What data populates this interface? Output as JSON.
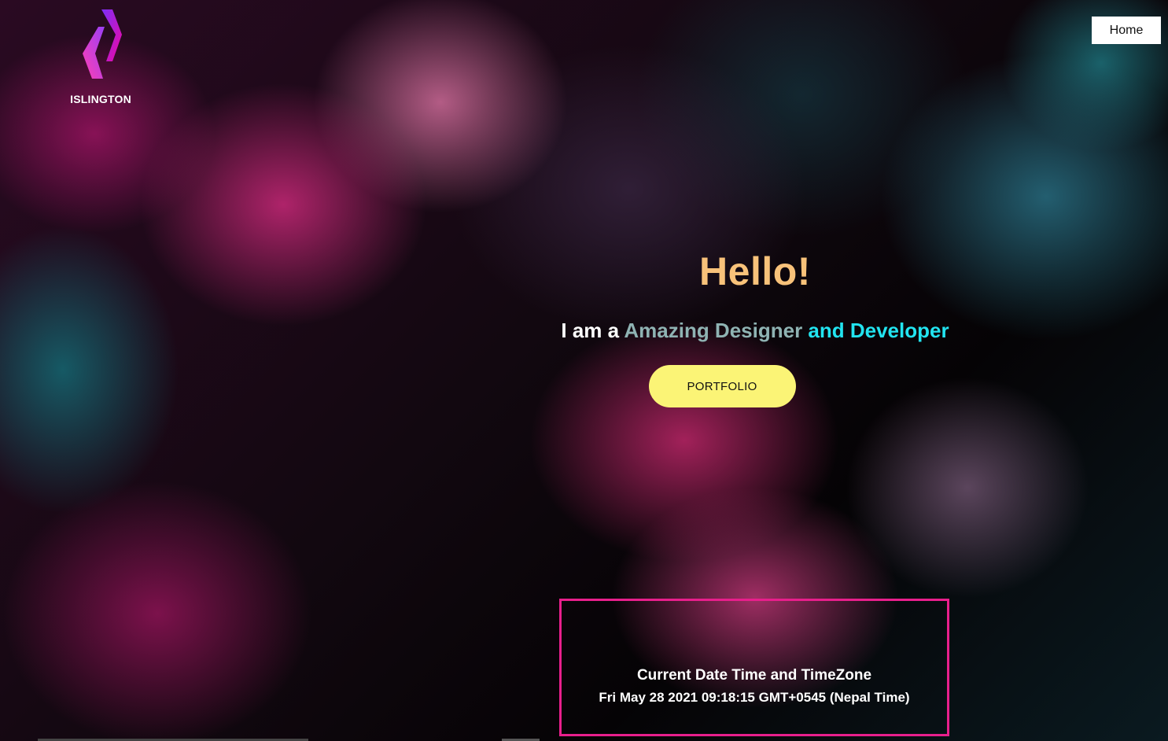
{
  "brand": {
    "logo_text": "ISLINGTON",
    "logo_icon": "islington-logo-icon",
    "gradient_from": "#7b2ff7",
    "gradient_to": "#f107a3"
  },
  "nav": {
    "home_label": "Home"
  },
  "hero": {
    "title": "Hello!",
    "subtitle_lead": "I am a ",
    "subtitle_mid": "Amazing Designer",
    "subtitle_end": " and Developer",
    "button_label": "PORTFOLIO"
  },
  "datetime": {
    "title": "Current Date Time and TimeZone",
    "value": "Fri May 28 2021 09:18:15 GMT+0545 (Nepal Time)"
  },
  "colors": {
    "title": "#f8c27a",
    "subtitle_mid": "#8fb3b3",
    "subtitle_end": "#22e4f0",
    "button_bg": "#fbf476",
    "box_border": "#e81f8c"
  }
}
